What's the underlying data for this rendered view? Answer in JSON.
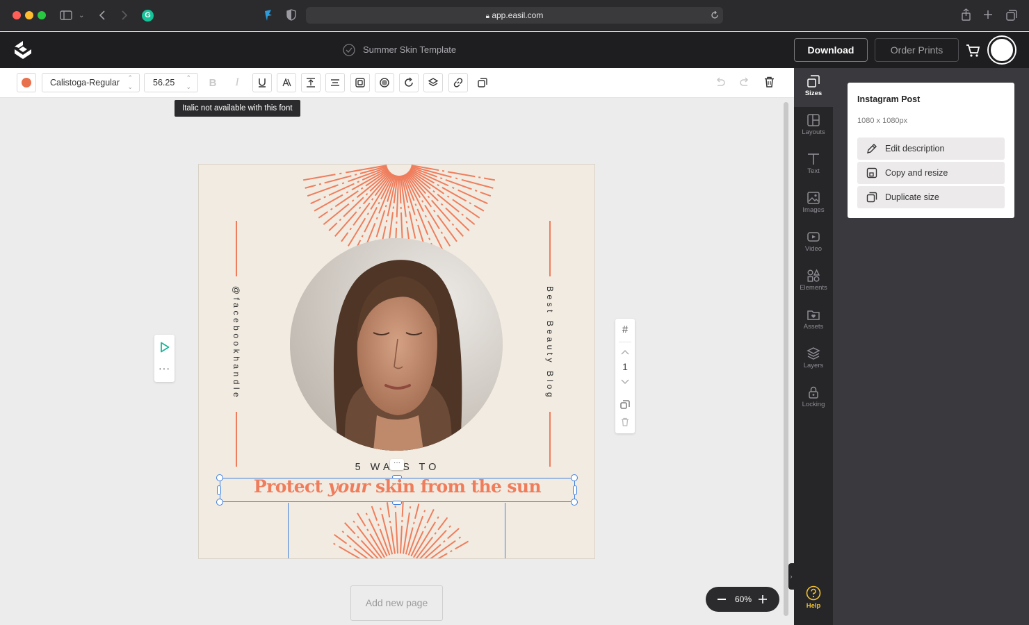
{
  "browser": {
    "url": "app.easil.com",
    "traffic_colors": [
      "#ff5f57",
      "#febc2e",
      "#28c840"
    ]
  },
  "header": {
    "doc_title": "Summer Skin Template",
    "download_label": "Download",
    "order_prints_label": "Order Prints"
  },
  "toolbar": {
    "text_color": "#e8704d",
    "font_name": "Calistoga-Regular",
    "font_size": "56.25",
    "tooltip": "Italic not available with this font"
  },
  "design": {
    "side_left": "@facebookhandle",
    "side_right": "Best Beauty Blog",
    "subtitle": "5 WAYS TO",
    "headline_before": "Protect ",
    "headline_italic": "your",
    "headline_after": " skin from the sun",
    "accent_color": "#ef7d5c",
    "background_color": "#f2ebe1"
  },
  "page_controls": {
    "page_number": "1"
  },
  "canvas": {
    "add_page_label": "Add new page",
    "zoom": "60%"
  },
  "sidebar": {
    "items": [
      {
        "label": "Sizes",
        "icon": "sizes-icon"
      },
      {
        "label": "Layouts",
        "icon": "layouts-icon"
      },
      {
        "label": "Text",
        "icon": "text-icon"
      },
      {
        "label": "Images",
        "icon": "images-icon"
      },
      {
        "label": "Video",
        "icon": "video-icon"
      },
      {
        "label": "Elements",
        "icon": "elements-icon"
      },
      {
        "label": "Assets",
        "icon": "assets-icon"
      },
      {
        "label": "Layers",
        "icon": "layers-icon"
      },
      {
        "label": "Locking",
        "icon": "lock-icon"
      }
    ],
    "help_label": "Help"
  },
  "size_panel": {
    "title": "Instagram Post",
    "dimensions": "1080 x 1080px",
    "edit_description": "Edit description",
    "copy_resize": "Copy and resize",
    "duplicate_size": "Duplicate size"
  }
}
